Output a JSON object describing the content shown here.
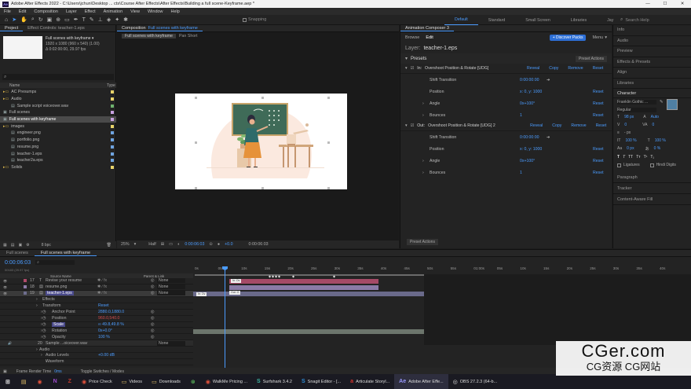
{
  "titlebar": {
    "app_icon": "Ae",
    "title": "Adobe After Effects 2022 - C:\\Users\\jchun\\Desktop ... cts\\Course After Effects\\After Effects\\Building a full scene-Keyframe.aep *",
    "min": "—",
    "max": "☐",
    "close": "✕"
  },
  "menu": [
    "File",
    "Edit",
    "Composition",
    "Layer",
    "Effect",
    "Animation",
    "View",
    "Window",
    "Help"
  ],
  "toolbar": {
    "snapping_label": "Snapping",
    "workspaces": [
      "Default",
      "Standard",
      "Small Screen",
      "Libraries",
      "Jay"
    ],
    "active_workspace": "Default",
    "search_placeholder": "Search Help"
  },
  "project_panel": {
    "tabs": [
      "Project",
      "Effect Controls: teacher-1.eps"
    ],
    "selected_name": "Full scenes with keyframe ▾",
    "selected_info": "1920 x 1080 (960 x 540) (1.00)",
    "selected_duration": "Δ 0:02:00:00, 29.97 fps",
    "search_icon": "search-icon",
    "col_name": "Name",
    "col_type": "Type",
    "items": [
      {
        "label": "AC Presumps",
        "kind": "folder",
        "indent": 0,
        "color": "#e8d36a",
        "selected": false
      },
      {
        "label": "Audio",
        "kind": "folder",
        "indent": 0,
        "color": "#e8d36a",
        "selected": false
      },
      {
        "label": "Sample script voiceover.wav",
        "kind": "file",
        "indent": 1,
        "color": "#6fb36f",
        "selected": false
      },
      {
        "label": "Full scenes",
        "kind": "comp",
        "indent": 0,
        "color": "#c8a1e0",
        "selected": false
      },
      {
        "label": "Full scenes with keyframe",
        "kind": "comp",
        "indent": 0,
        "color": "#c8a1e0",
        "selected": true
      },
      {
        "label": "images",
        "kind": "folder",
        "indent": 0,
        "color": "#e8d36a",
        "selected": false
      },
      {
        "label": "engineer.png",
        "kind": "file",
        "indent": 1,
        "color": "#6fa4e0",
        "selected": false
      },
      {
        "label": "portfolio.png",
        "kind": "file",
        "indent": 1,
        "color": "#6fa4e0",
        "selected": false
      },
      {
        "label": "resume.png",
        "kind": "file",
        "indent": 1,
        "color": "#6fa4e0",
        "selected": false
      },
      {
        "label": "teacher-1.eps",
        "kind": "file",
        "indent": 1,
        "color": "#6fa4e0",
        "selected": false
      },
      {
        "label": "teacher2a.eps",
        "kind": "file",
        "indent": 1,
        "color": "#6fa4e0",
        "selected": false
      },
      {
        "label": "Solids",
        "kind": "folder",
        "indent": 0,
        "color": "#e8d36a",
        "selected": false
      }
    ],
    "bpc": "8 bpc"
  },
  "comp_panel": {
    "tab_label": "Composition",
    "tab_comp": "Full scenes with keyframe",
    "subtab1": "Full scenes with keyframe",
    "subtab2": "Pan Short",
    "zoom": "25%",
    "resolution": "Half",
    "timecode": "0:00:06:03",
    "exposure": "+0.0"
  },
  "animation_composer": {
    "tab": "Animation Composer 3",
    "browse": "Browse",
    "edit": "Edit",
    "discover": "+ Discover Packs",
    "menu": "Menu",
    "layer_label": "Layer:",
    "layer_name": "teacher-1.eps",
    "presets_title": "Presets",
    "preset_actions": "Preset Actions",
    "bottom_preset_actions": "Preset Actions",
    "presets": [
      {
        "prefix": "In:",
        "name": "Overshoot Position & Rotate [UDG]",
        "reveal": "Reveal",
        "copy": "Copy",
        "remove": "Remove",
        "reset": "Reset",
        "props": [
          {
            "label": "Shift Transition",
            "value": "0:00:00:00",
            "reset": ""
          },
          {
            "label": "Position",
            "value": "x: 0, y: 1000",
            "reset": "Reset"
          },
          {
            "label": "Angle",
            "value": "0x+100°",
            "reset": "Reset"
          },
          {
            "label": "Bounces",
            "value": "1",
            "reset": "Reset"
          }
        ]
      },
      {
        "prefix": "Out:",
        "name": "Overshoot Position & Rotate [UDG] 2",
        "reveal": "Reveal",
        "copy": "Copy",
        "remove": "Remove",
        "reset": "Reset",
        "props": [
          {
            "label": "Shift Transition",
            "value": "0:00:00:00",
            "reset": ""
          },
          {
            "label": "Position",
            "value": "x: 0, y: 1000",
            "reset": "Reset"
          },
          {
            "label": "Angle",
            "value": "0x+100°",
            "reset": "Reset"
          },
          {
            "label": "Bounces",
            "value": "1",
            "reset": "Reset"
          }
        ]
      }
    ]
  },
  "right_panels": {
    "items": [
      "Info",
      "Audio",
      "Preview",
      "Effects & Presets",
      "Align",
      "Libraries"
    ],
    "character_title": "Character",
    "font": "Franklin Gothic ...",
    "style": "Regular",
    "font_size": "98 px",
    "leading": "Auto",
    "tracking": "0",
    "unit": "- px",
    "scale_v": "100 %",
    "scale_h": "100 %",
    "baseline": "0 px",
    "tsume": "0 %",
    "ligatures": "Ligatures",
    "hindi": "Hindi Digits",
    "bottom_items": [
      "Paragraph",
      "Tracker",
      "Content-Aware Fill"
    ]
  },
  "timeline": {
    "tabs": [
      "Full scenes",
      "Full scenes with keyframe"
    ],
    "timecode": "0:00:06:03",
    "fps_line": "00183 (29.97 fps)",
    "search_icon": "search-icon",
    "col_source": "Source Name",
    "col_parent": "Parent & Link",
    "ruler": [
      "0s",
      "05s",
      "10s",
      "15s",
      "20s",
      "25s",
      "30s",
      "35s",
      "40s",
      "45s",
      "50s",
      "55s",
      "01:00s",
      "05s",
      "10s",
      "15s",
      "20s",
      "25s",
      "30s",
      "35s",
      "40s"
    ],
    "layers": [
      {
        "num": "17",
        "type": "T",
        "name": "Revise your resume",
        "parent": "None",
        "color": "#b04a6a"
      },
      {
        "num": "18",
        "type": "img",
        "name": "resume.png",
        "parent": "None",
        "color": "#8d7aa8"
      },
      {
        "num": "19",
        "type": "img",
        "name": "teacher-1.eps",
        "parent": "None",
        "color": "#6e6e8e",
        "selected": true
      }
    ],
    "bar_labels": [
      "In: Ov",
      "Out: O",
      "In: Ov"
    ],
    "props": [
      {
        "label": "Effects",
        "value": "",
        "indent": 1
      },
      {
        "label": "Transform",
        "value": "Reset",
        "indent": 1
      },
      {
        "label": "Anchor Point",
        "value": "2880.0,1880.0",
        "indent": 2
      },
      {
        "label": "Position",
        "value": "960.0,540.0",
        "indent": 2
      },
      {
        "label": "Scale",
        "value": "∞ 49.8,49.8 %",
        "indent": 2
      },
      {
        "label": "Rotation",
        "value": "0x+0.0°",
        "indent": 2
      },
      {
        "label": "Opacity",
        "value": "100 %",
        "indent": 2
      }
    ],
    "audio_layer": {
      "num": "20",
      "name": "Sample ...oiceover.wav",
      "parent": "None"
    },
    "audio_props": [
      {
        "label": "Audio",
        "value": ""
      },
      {
        "label": "Audio Levels",
        "value": "+0.00 dB"
      },
      {
        "label": "Waveform",
        "value": ""
      }
    ],
    "frame_render": "Frame Render Time",
    "frame_render_val": "0ms",
    "toggle_switches": "Toggle Switches / Modes"
  },
  "taskbar": {
    "items": [
      {
        "label": "",
        "icon": "windows-icon"
      },
      {
        "label": "",
        "icon": "explorer-icon"
      },
      {
        "label": "",
        "icon": "chrome-icon"
      },
      {
        "label": "",
        "icon": "onenote-icon"
      },
      {
        "label": "",
        "icon": "filezilla-icon"
      },
      {
        "label": "Price Check",
        "icon": "chrome-icon"
      },
      {
        "label": "Videos",
        "icon": "folder-icon"
      },
      {
        "label": "Downloads",
        "icon": "folder-icon"
      },
      {
        "label": "",
        "icon": "xbox-icon"
      },
      {
        "label": "WalkMe Pricing ...",
        "icon": "chrome-icon"
      },
      {
        "label": "Surfshark 3.4.2",
        "icon": "surfshark-icon"
      },
      {
        "label": "Snagit Editor - [...",
        "icon": "snagit-icon"
      },
      {
        "label": "Articulate Storyl...",
        "icon": "articulate-icon"
      },
      {
        "label": "Adobe After Effe...",
        "icon": "ae-icon"
      },
      {
        "label": "OBS 27.2.3 (64-b...",
        "icon": "obs-icon"
      }
    ]
  },
  "watermark": {
    "line1": "CGer.com",
    "line2": "CG资源 CG网站"
  },
  "colors": {
    "accent": "#4b9cff",
    "ae_purple": "#9999ff",
    "playhead": "#4b9cff",
    "layer_pink": "#b04a6a",
    "layer_lilac": "#8d7aa8",
    "canvas_bg": "#fbeee6"
  }
}
